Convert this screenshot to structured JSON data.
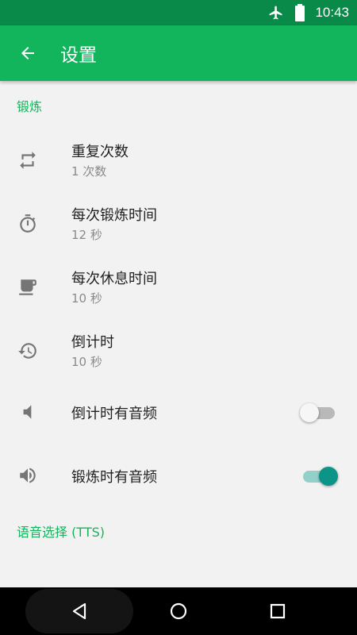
{
  "status_bar": {
    "time": "10:43",
    "icons": [
      "airplane-icon",
      "battery-icon"
    ]
  },
  "app_bar": {
    "title": "设置",
    "back_icon": "arrow-back-icon"
  },
  "sections": [
    {
      "header": "锻炼",
      "items": [
        {
          "title": "重复次数",
          "summary": "1 次数",
          "icon": "repeat-icon"
        },
        {
          "title": "每次锻炼时间",
          "summary": "12 秒",
          "icon": "timer-icon"
        },
        {
          "title": "每次休息时间",
          "summary": "10 秒",
          "icon": "coffee-icon"
        },
        {
          "title": "倒计时",
          "summary": "10 秒",
          "icon": "history-icon"
        },
        {
          "title": "倒计时有音频",
          "icon": "volume-low-icon",
          "switch": "off"
        },
        {
          "title": "锻炼时有音频",
          "icon": "volume-high-icon",
          "switch": "on"
        }
      ]
    },
    {
      "header": "语音选择 (TTS)",
      "items": []
    }
  ],
  "colors": {
    "status_bar": "#0a8a48",
    "app_bar": "#13b55c",
    "accent_text": "#13b55c",
    "switch_on_thumb": "#0c9488",
    "switch_on_track": "#93d0c9"
  },
  "nav_bar": {
    "buttons": [
      "back-triangle-icon",
      "home-circle-icon",
      "recents-square-icon"
    ]
  }
}
